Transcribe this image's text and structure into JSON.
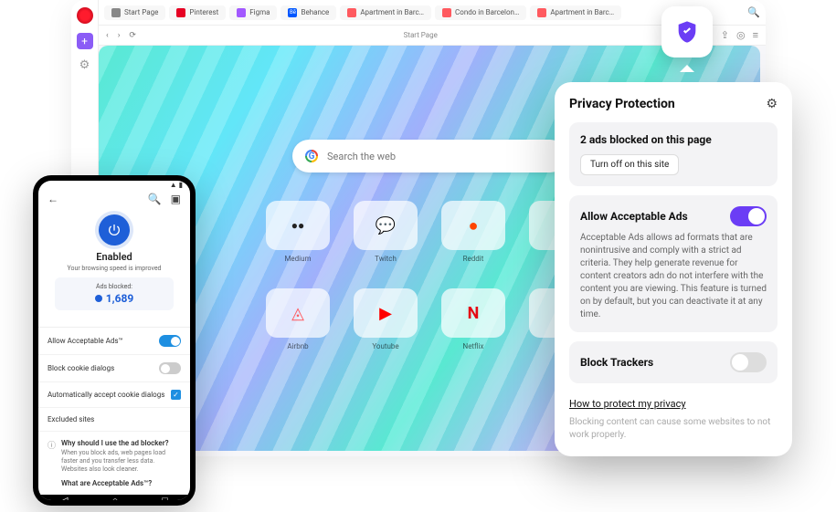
{
  "desktop": {
    "tabs": [
      {
        "label": "Start Page",
        "favColor": "#888"
      },
      {
        "label": "Pinterest",
        "favColor": "#e60023"
      },
      {
        "label": "Figma",
        "favColor": "#a259ff"
      },
      {
        "label": "Behance",
        "favColor": "#0057ff"
      },
      {
        "label": "Apartment in Barc…",
        "favColor": "#ff5a5f"
      },
      {
        "label": "Condo in Barcelon…",
        "favColor": "#ff5a5f"
      },
      {
        "label": "Apartment in Barc…",
        "favColor": "#ff5a5f"
      }
    ],
    "addressLabel": "Start Page",
    "search": {
      "placeholder": "Search the web"
    },
    "tiles": [
      {
        "label": "Medium",
        "glyph": "●●●"
      },
      {
        "label": "Twitch",
        "glyph": "▶"
      },
      {
        "label": "Reddit",
        "glyph": "☺",
        "color": "#ff4500"
      },
      {
        "label": "",
        "glyph": ""
      },
      {
        "label": "Airbnb",
        "glyph": "◬",
        "color": "#ff5a5f"
      },
      {
        "label": "Youtube",
        "glyph": "▶",
        "color": "#ff0000"
      },
      {
        "label": "Netflix",
        "glyph": "N",
        "color": "#e50914"
      },
      {
        "label": "",
        "glyph": ""
      }
    ]
  },
  "privacy": {
    "title": "Privacy Protection",
    "blocked": "2 ads blocked on this page",
    "turnOff": "Turn off on this site",
    "allowTitle": "Allow Acceptable Ads",
    "allowDesc": "Acceptable Ads allows ad formats that are nonintrusive and comply with a strict ad criteria. They help generate revenue for content creators adn do not interfere with the content you are viewing. This feature is turned on by default, but you can deactivate it at any time.",
    "blockTrackers": "Block Trackers",
    "howTo": "How to protect my privacy",
    "note": "Blocking content can cause some websites to not work properly."
  },
  "phone": {
    "enabled": "Enabled",
    "subtitle": "Your browsing speed is improved",
    "adsBlockedLabel": "Ads blocked:",
    "adsBlockedValue": "1,689",
    "allowAds": "Allow Acceptable Ads™",
    "blockCookie": "Block cookie dialogs",
    "autoAccept": "Automatically accept cookie dialogs",
    "excluded": "Excluded sites",
    "faq1Title": "Why should I use the ad blocker?",
    "faq1Body": "When you block ads, web pages load faster and you transfer less data. Websites also look cleaner.",
    "faq2Title": "What are Acceptable Ads™?"
  }
}
